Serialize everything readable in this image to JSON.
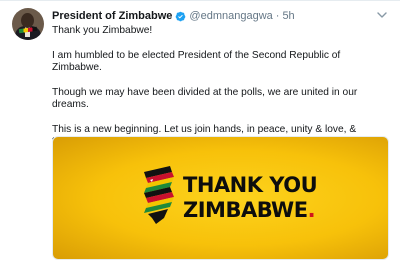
{
  "tweet": {
    "author_name": "President of Zimbabwe",
    "handle": "@edmnangagwa",
    "separator": "·",
    "time": "5h",
    "paragraphs": [
      "Thank you Zimbabwe!",
      "I am humbled to be elected President of the Second Republic of Zimbabwe.",
      "Though we may have been divided at the polls, we are united in our dreams.",
      "This is a new beginning. Let us join hands, in peace, unity & love, & together build a new Zimbabwe for all!"
    ],
    "image": {
      "line1": "THANK YOU",
      "line2": "ZIMBABWE",
      "line2_punct": "."
    }
  },
  "icons": {
    "verified": "verified-badge-icon",
    "menu": "chevron-down-icon",
    "logo": "zimbabwe-stripes-logo"
  },
  "colors": {
    "verified_blue": "#1da1f2",
    "secondary_text": "#657786",
    "banner_yellow": "#f7c10a",
    "flag_green": "#1f8a3b",
    "flag_red": "#c8102e",
    "flag_yellow": "#f2c600",
    "flag_black": "#111111"
  }
}
